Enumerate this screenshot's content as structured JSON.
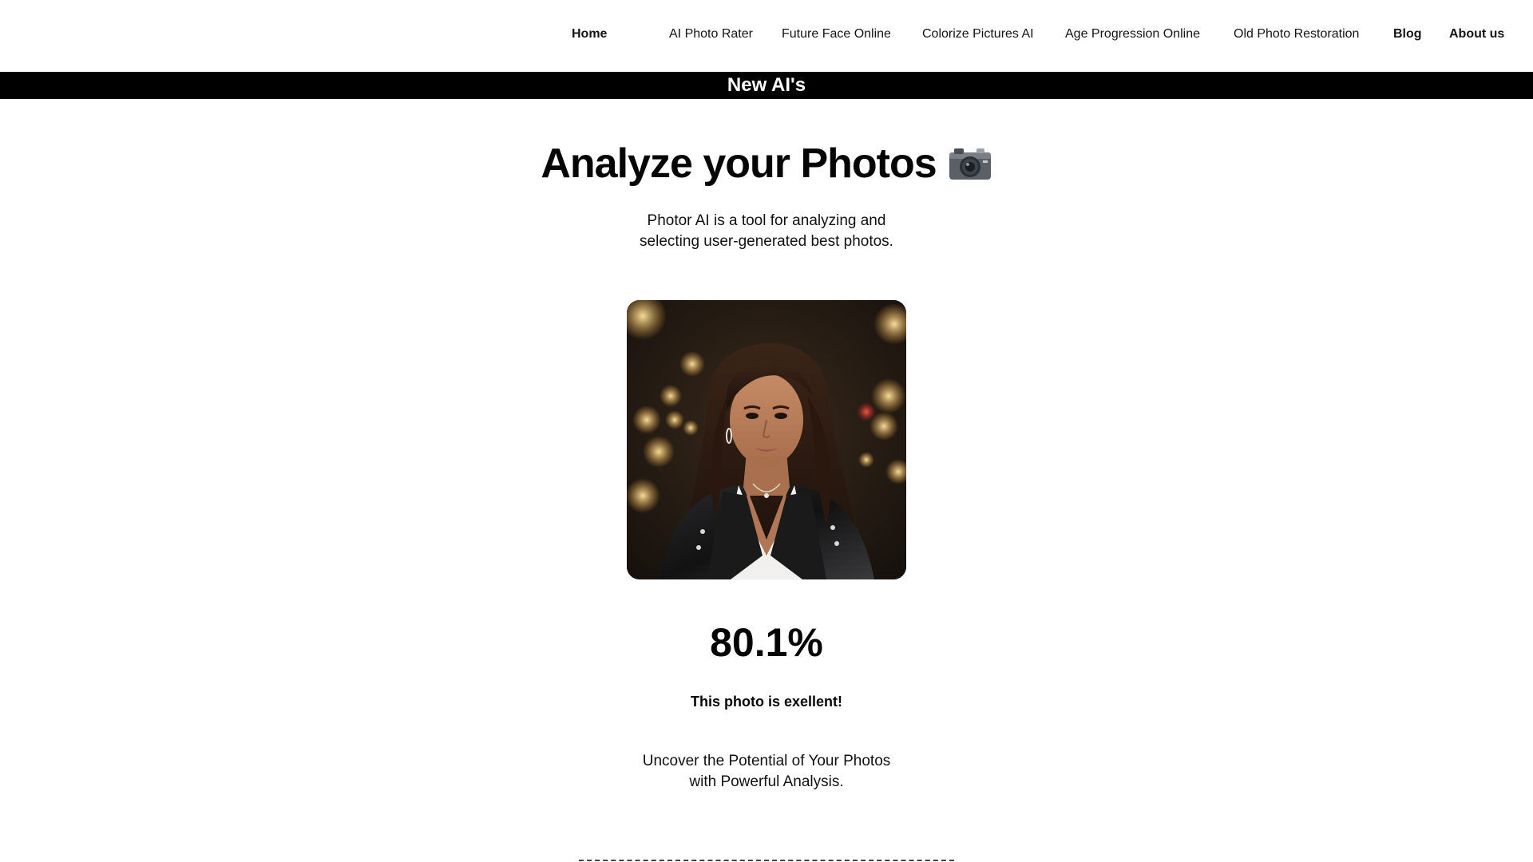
{
  "nav": {
    "items": [
      {
        "label": "Home"
      },
      {
        "label": "AI Photo Rater"
      },
      {
        "label": "Future Face Online"
      },
      {
        "label": "Colorize Pictures AI"
      },
      {
        "label": "Age Progression Online"
      },
      {
        "label": "Old Photo Restoration"
      },
      {
        "label": "Blog"
      },
      {
        "label": "About us"
      }
    ]
  },
  "banner": {
    "label": "New AI's"
  },
  "hero": {
    "title": "Analyze your Photos",
    "title_icon": "camera-icon",
    "subtitle_line1": "Photor AI is a tool for analyzing and",
    "subtitle_line2": "selecting user-generated best photos."
  },
  "result": {
    "photo_icon": "portrait-photo",
    "score": "80.1%",
    "verdict": "This photo is exellent!",
    "tagline_line1": "Uncover the Potential of Your Photos",
    "tagline_line2": "with Powerful Analysis."
  },
  "colors": {
    "banner_bg": "#000000",
    "banner_text": "#ffffff",
    "text": "#111111"
  }
}
